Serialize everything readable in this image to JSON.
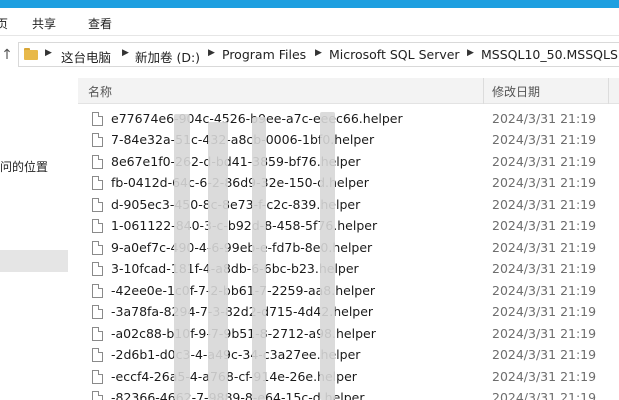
{
  "ribbon": {
    "tabs": [
      "页",
      "共享",
      "查看"
    ]
  },
  "address": {
    "crumbs": [
      "这台电脑",
      "新加卷 (D:)",
      "Program Files",
      "Microsoft SQL Server",
      "MSSQL10_50.MSSQLSE"
    ]
  },
  "nav": {
    "items": [
      "问的位置"
    ]
  },
  "columns": {
    "name": "名称",
    "date": "修改日期"
  },
  "files": [
    {
      "name": "e77674e6-904c-4526-b9ee-a7c-eeec66.helper",
      "date": "2024/3/31 21:19"
    },
    {
      "name": "7-84e32a-51c-432-a8cb-0006-1bf0.helper",
      "date": "2024/3/31 21:19"
    },
    {
      "name": "8e67e1f0-262-d-bd41-3859-bf76.helper",
      "date": "2024/3/31 21:19"
    },
    {
      "name": "fb-0412d-64c-6-2-86d9-32e-150-d.helper",
      "date": "2024/3/31 21:19"
    },
    {
      "name": "d-905ec3-450-8c-8e73-f-c2c-839.helper",
      "date": "2024/3/31 21:19"
    },
    {
      "name": "1-061122-840-3-c-b92d-8-458-5f76.helper",
      "date": "2024/3/31 21:19"
    },
    {
      "name": "9-a0ef7c-490-4-6-99eb-e-fd7b-8e0.helper",
      "date": "2024/3/31 21:19"
    },
    {
      "name": "3-10fcad-181f-4-a8db-6-6bc-b23.helper",
      "date": "2024/3/31 21:19"
    },
    {
      "name": "-42ee0e-1c0f-7-2-bb61-7-2259-aa8.helper",
      "date": "2024/3/31 21:19"
    },
    {
      "name": "-3a78fa-8294-7-3-82d2-d715-4d42.helper",
      "date": "2024/3/31 21:19"
    },
    {
      "name": "-a02c88-b10f-9-7-9b51-8-2712-a98.helper",
      "date": "2024/3/31 21:19"
    },
    {
      "name": "-2d6b1-d0c3-4-a49c-34-c3a27ee.helper",
      "date": "2024/3/31 21:19"
    },
    {
      "name": "-eccf4-26a5-4-a768-cf-914e-26e.helper",
      "date": "2024/3/31 21:19"
    },
    {
      "name": "-82366-4662-7-9889-8-e64-15c-d.helper",
      "date": "2024/3/31 21:19"
    }
  ]
}
